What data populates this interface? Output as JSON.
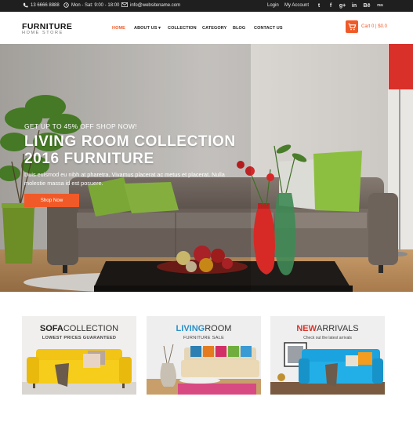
{
  "topbar": {
    "phone": "13 6666 8888",
    "hours": "Mon - Sat: 9:00 - 18:00",
    "email": "info@websitename.com",
    "login": "Login",
    "account": "My Account",
    "social": [
      {
        "name": "twitter-icon",
        "glyph": "t"
      },
      {
        "name": "facebook-icon",
        "glyph": "f"
      },
      {
        "name": "google-plus-icon",
        "glyph": "g+"
      },
      {
        "name": "linkedin-icon",
        "glyph": "in"
      },
      {
        "name": "behance-icon",
        "glyph": "Bē"
      },
      {
        "name": "rss-icon",
        "glyph": "rss"
      }
    ]
  },
  "header": {
    "logo_main": "FURNITURE",
    "logo_sub": "HOME STORE",
    "nav": [
      "HOME",
      "ABOUT US ▾",
      "COLLECTION",
      "CATEGORY",
      "BLOG",
      "CONTACT US"
    ],
    "cart_text": "Cart 0 | $0.0"
  },
  "hero": {
    "kicker": "GET UP TO 45% OFF SHOP NOW!",
    "title_line1": "LIVING ROOM COLLECTION",
    "title_line2": "2016 FURNITURE",
    "desc": "Duis euismod eu nibh at pharetra. Vivamus placerat ac metus et placerat. Nulla molestie massa id est posuere.",
    "button": "Shop Now"
  },
  "cards": [
    {
      "title_strong": "SOFA",
      "title_rest": "COLLECTION",
      "subtitle": "LOWEST PRICES GUARANTEED",
      "strong_color": "#222222"
    },
    {
      "title_strong": "LIVING",
      "title_rest": "ROOM",
      "subtitle": "FURNITURE SALE",
      "strong_color": "#2a8fc9"
    },
    {
      "title_strong": "NEW",
      "title_rest": "ARRIVALS",
      "subtitle": "Check out the latest arrivals",
      "strong_color": "#d9342b"
    }
  ],
  "colors": {
    "accent": "#f05a28",
    "topbar": "#1f1f1f"
  }
}
